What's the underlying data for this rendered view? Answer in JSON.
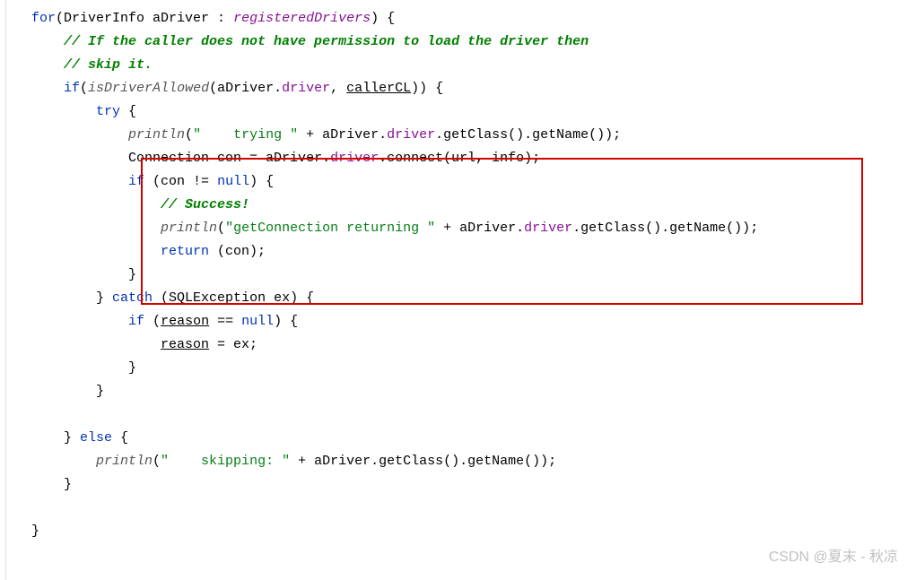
{
  "code": {
    "l1_for": "for",
    "l1_a": "(DriverInfo aDriver : ",
    "l1_reg": "registeredDrivers",
    "l1_b": ") {",
    "l2": "// If the caller does not have permission to load the driver then",
    "l3": "// skip it.",
    "l4_if": "if",
    "l4_a": "(",
    "l4_m": "isDriverAllowed",
    "l4_b": "(aDriver.",
    "l4_drv": "driver",
    "l4_c": ", ",
    "l4_cl": "callerCL",
    "l4_d": ")) {",
    "l5_try": "try",
    "l5_a": " {",
    "l6_pln": "println",
    "l6_a": "(",
    "l6_s": "\"    trying \"",
    "l6_b": " + aDriver.",
    "l6_drv": "driver",
    "l6_c": ".getClass().getName());",
    "l7_a": "Connection con = aDriver.",
    "l7_drv": "driver",
    "l7_b": ".connect(url, info);",
    "l8_if": "if",
    "l8_a": " (con != ",
    "l8_null": "null",
    "l8_b": ") {",
    "l9": "// Success!",
    "l10_pln": "println",
    "l10_a": "(",
    "l10_s": "\"getConnection returning \"",
    "l10_b": " + aDriver.",
    "l10_drv": "driver",
    "l10_c": ".getClass().getName());",
    "l11_ret": "return",
    "l11_a": " (con);",
    "l12": "}",
    "l13_a": "} ",
    "l13_catch": "catch",
    "l13_b": " (SQLException ex) {",
    "l14_if": "if",
    "l14_a": " (",
    "l14_r": "reason",
    "l14_b": " == ",
    "l14_null": "null",
    "l14_c": ") {",
    "l15_r": "reason",
    "l15_a": " = ex;",
    "l16": "}",
    "l17": "}",
    "l18": "",
    "l19_a": "} ",
    "l19_else": "else",
    "l19_b": " {",
    "l20_pln": "println",
    "l20_a": "(",
    "l20_s": "\"    skipping: \"",
    "l20_b": " + aDriver.getClass().getName());",
    "l21": "}",
    "l22": "",
    "l23": "}"
  },
  "watermark": "CSDN @夏末 - 秋凉"
}
